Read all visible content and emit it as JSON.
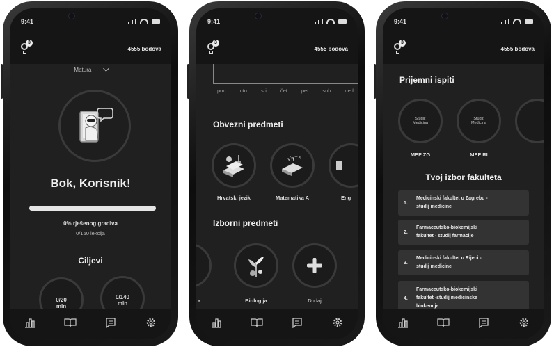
{
  "status_time": "9:41",
  "header": {
    "notif_count": "3",
    "points": "4555 bodova"
  },
  "screen1": {
    "dropdown": "Matura",
    "greeting": "Bok, Korisnik!",
    "progress_percent": 0,
    "progress_text": "0% rješenog gradiva",
    "lessons_text": "0/150 lekcija",
    "goals_title": "Ciljevi",
    "goals": [
      {
        "value": "0/20",
        "unit": "min"
      },
      {
        "value": "0/140",
        "unit": "min"
      }
    ]
  },
  "screen2": {
    "days": [
      "pon",
      "uto",
      "sri",
      "čet",
      "pet",
      "sub",
      "ned"
    ],
    "mandatory_title": "Obvezni predmeti",
    "mandatory": [
      "Hrvatski jezik",
      "Matematika A",
      "Eng"
    ],
    "elective_title": "Izborni predmeti",
    "elective": [
      "a",
      "Biologija",
      "Dodaj"
    ]
  },
  "screen3": {
    "exams_title": "Prijemni ispiti",
    "exams": [
      {
        "line1": "Studij:",
        "line2": "Medicina",
        "label": "MEF ZG"
      },
      {
        "line1": "Studij:",
        "line2": "Medicina",
        "label": "MEF RI"
      }
    ],
    "choice_title": "Tvoj izbor fakulteta",
    "choices": [
      {
        "n": "1.",
        "l1": "Medicinski fakultet u Zagrebu -",
        "l2": "studij medicine",
        "l3": ""
      },
      {
        "n": "2.",
        "l1": "Farmaceutsko-biokemijski",
        "l2": "fakultet - studij farmacije",
        "l3": ""
      },
      {
        "n": "3.",
        "l1": "Medicinski fakultet u Rijeci -",
        "l2": "studij medicine",
        "l3": ""
      },
      {
        "n": "4.",
        "l1": "Farmaceutsko-biokemijski",
        "l2": "fakultet -studij medicinske",
        "l3": "biokemije"
      }
    ]
  },
  "nav_icons": [
    "chart-icon",
    "book-icon",
    "chat-icon",
    "settings-icon"
  ]
}
